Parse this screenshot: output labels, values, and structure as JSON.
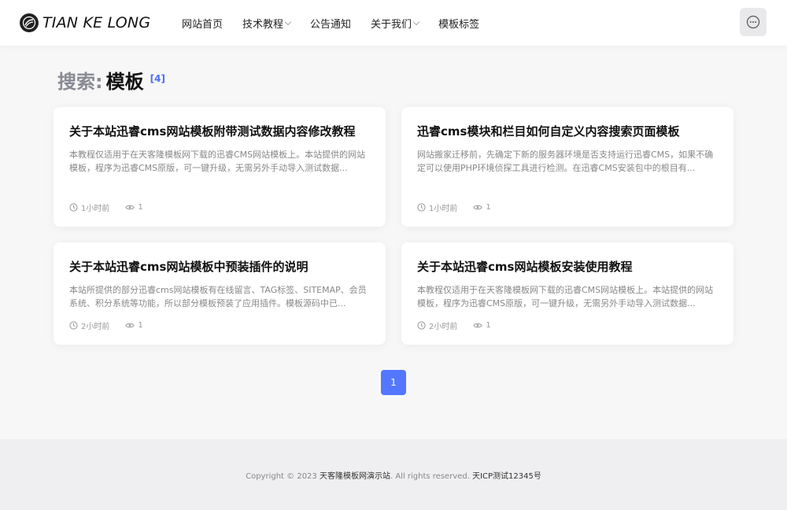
{
  "header": {
    "logo_text": "TIAN KE LONG",
    "nav": [
      {
        "label": "网站首页",
        "has_caret": false
      },
      {
        "label": "技术教程",
        "has_caret": true
      },
      {
        "label": "公告通知",
        "has_caret": false
      },
      {
        "label": "关于我们",
        "has_caret": true
      },
      {
        "label": "模板标签",
        "has_caret": false
      }
    ],
    "menu_icon": "more-dots-icon"
  },
  "search": {
    "label": "搜索:",
    "term": "模板",
    "count": "[4]"
  },
  "articles": [
    {
      "title": "关于本站迅睿cms网站模板附带测试数据内容修改教程",
      "desc": "本教程仅适用于在天客隆模板网下载的迅睿CMS网站模板上。本站提供的网站模板，程序为迅睿CMS原版，可一键升级，无需另外手动导入测试数据...",
      "time": "1小时前",
      "views": "1"
    },
    {
      "title": "迅睿cms模块和栏目如何自定义内容搜索页面模板",
      "desc": "网站搬家迁移前，先确定下新的服务器环境是否支持运行迅睿CMS，如果不确定可以使用PHP环境侦探工具进行检测。在迅睿CMS安装包中的根目有...",
      "time": "1小时前",
      "views": "1"
    },
    {
      "title": "关于本站迅睿cms网站模板中预装插件的说明",
      "desc": "本站所提供的部分迅睿cms网站模板有在线留言、TAG标签、SITEMAP、会员系统、积分系统等功能，所以部分模板预装了应用插件。模板源码中已...",
      "time": "2小时前",
      "views": "1"
    },
    {
      "title": "关于本站迅睿cms网站模板安装使用教程",
      "desc": "本教程仅适用于在天客隆模板网下载的迅睿CMS网站模板上。本站提供的网站模板，程序为迅睿CMS原版，可一键升级，无需另外手动导入测试数据...",
      "time": "2小时前",
      "views": "1"
    }
  ],
  "pagination": {
    "current": "1"
  },
  "footer": {
    "copyright": "Copyright © 2023",
    "site_name": "天客隆模板网演示站",
    "rights": ". All rights reserved.",
    "icp": "天ICP测试12345号"
  },
  "colors": {
    "accent": "#5377ff",
    "count": "#4a6cf7"
  }
}
